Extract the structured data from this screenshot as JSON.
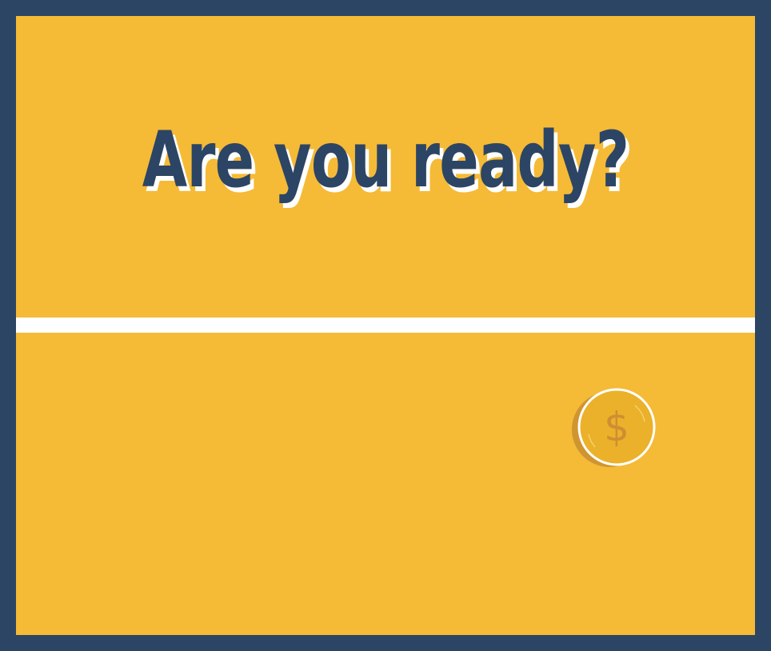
{
  "game": {
    "title": "Are you ready?",
    "coin_icon": "dollar-coin-icon",
    "coin_symbol": "$"
  },
  "colors": {
    "frame": "#2c4565",
    "background": "#f5ba36",
    "divider": "#ffffff",
    "title": "#2c4565",
    "coin_face": "#ebb12a",
    "coin_edge": "#cf9530",
    "coin_symbol": "#cd8f32"
  }
}
